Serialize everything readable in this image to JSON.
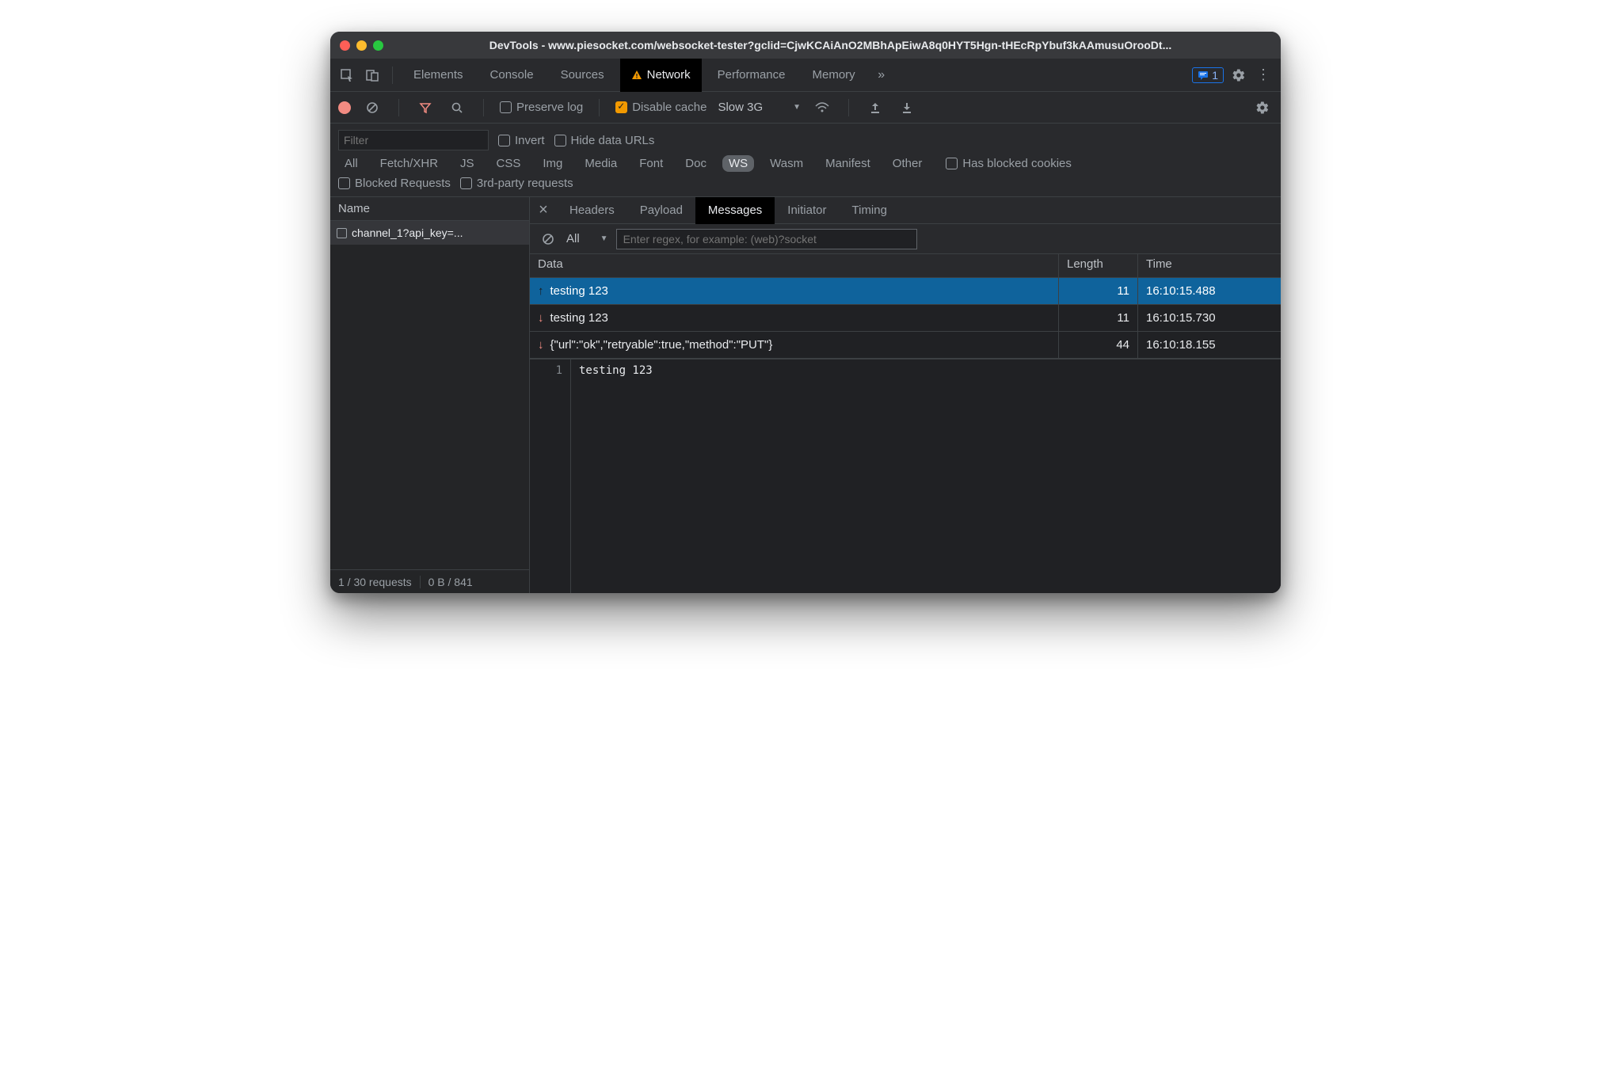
{
  "window": {
    "title": "DevTools - www.piesocket.com/websocket-tester?gclid=CjwKCAiAnO2MBhApEiwA8q0HYT5Hgn-tHEcRpYbuf3kAAmusuOrooDt..."
  },
  "main_tabs": {
    "items": [
      "Elements",
      "Console",
      "Sources",
      "Network",
      "Performance",
      "Memory"
    ],
    "active": "Network",
    "issue_count": "1"
  },
  "toolbar": {
    "preserve_log": "Preserve log",
    "disable_cache": "Disable cache",
    "throttle": "Slow 3G"
  },
  "filter": {
    "placeholder": "Filter",
    "invert": "Invert",
    "hide_data_urls": "Hide data URLs",
    "types": [
      "All",
      "Fetch/XHR",
      "JS",
      "CSS",
      "Img",
      "Media",
      "Font",
      "Doc",
      "WS",
      "Wasm",
      "Manifest",
      "Other"
    ],
    "active_type": "WS",
    "has_blocked_cookies": "Has blocked cookies",
    "blocked_requests": "Blocked Requests",
    "third_party": "3rd-party requests"
  },
  "requests": {
    "header": "Name",
    "rows": [
      "channel_1?api_key=..."
    ],
    "status_left": "1 / 30 requests",
    "status_right": "0 B / 841"
  },
  "detail_tabs": {
    "items": [
      "Headers",
      "Payload",
      "Messages",
      "Initiator",
      "Timing"
    ],
    "active": "Messages"
  },
  "messages_toolbar": {
    "filter_label": "All",
    "regex_placeholder": "Enter regex, for example: (web)?socket"
  },
  "messages_table": {
    "headers": {
      "data": "Data",
      "length": "Length",
      "time": "Time"
    },
    "rows": [
      {
        "dir": "up",
        "data": "testing 123",
        "length": "11",
        "time": "16:10:15.488",
        "selected": true
      },
      {
        "dir": "down",
        "data": "testing 123",
        "length": "11",
        "time": "16:10:15.730",
        "selected": false
      },
      {
        "dir": "down",
        "data": "{\"url\":\"ok\",\"retryable\":true,\"method\":\"PUT\"}",
        "length": "44",
        "time": "16:10:18.155",
        "selected": false
      }
    ]
  },
  "detail_view": {
    "line_no": "1",
    "content": "testing 123"
  }
}
